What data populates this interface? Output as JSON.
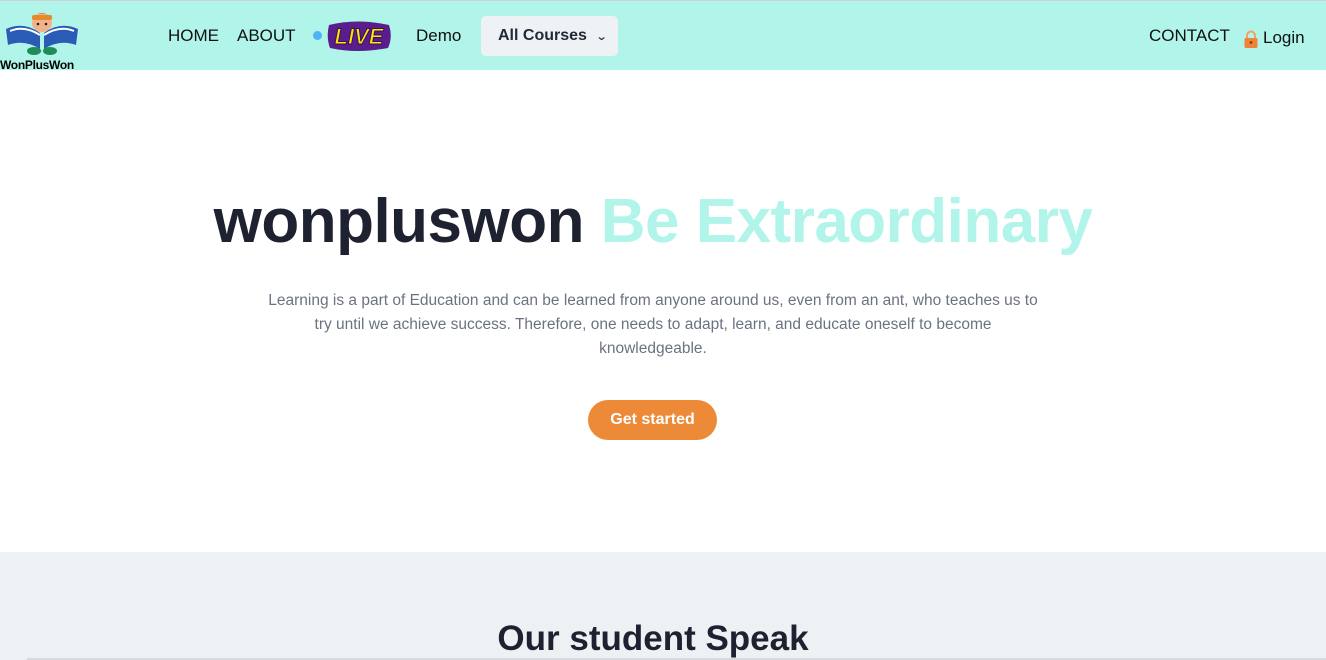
{
  "brand": {
    "name": "WonPlusWon"
  },
  "nav": {
    "home": "HOME",
    "about": "ABOUT",
    "live": "LIVE",
    "demo": "Demo",
    "courses": "All Courses",
    "contact": "CONTACT",
    "login": "Login"
  },
  "hero": {
    "title_main": "wonpluswon",
    "title_accent": "Be Extraordinary",
    "description": "Learning is a part of Education and can be learned from anyone around us, even from an ant, who teaches us to try until we achieve success. Therefore, one needs to adapt, learn, and educate oneself to become knowledgeable.",
    "cta": "Get started"
  },
  "testimonials": {
    "title": "Our student Speak"
  },
  "colors": {
    "navbar_bg": "#b1f4ea",
    "accent": "#b1f4ea",
    "cta": "#ec8a37",
    "section_bg": "#edf1f4",
    "live_fill": "#ffe600",
    "live_outline": "#5a1e8c"
  },
  "icons": {
    "logo": "boy-reading-book-icon",
    "courses_chevron": "chevron-down-icon",
    "login": "lock-icon",
    "live_dot": "live-dot-icon"
  }
}
